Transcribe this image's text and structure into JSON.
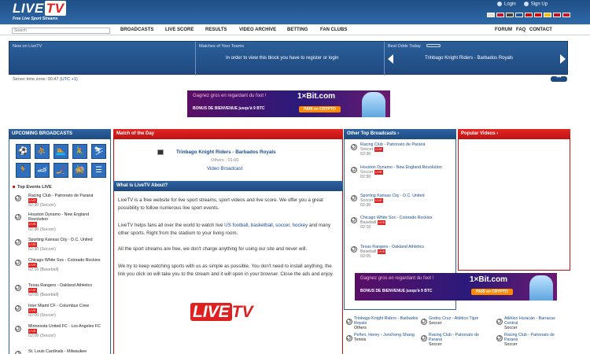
{
  "header": {
    "logo_live": "LIVE",
    "logo_tv": "TV",
    "tagline": "Free Live Sport Streams",
    "login": "Login",
    "signup": "Sign Up",
    "flags": [
      "#e0e0e0",
      "#c8102e",
      "#444",
      "#1e50a0",
      "#cc0000",
      "#d00",
      "#f1bf00",
      "#c60b1e",
      "#ce1126"
    ]
  },
  "nav": {
    "search_placeholder": "Search",
    "items": [
      "BROADCASTS",
      "LIVE SCORE",
      "RESULTS",
      "VIDEO ARCHIVE",
      "BETTING",
      "FAN CLUBS"
    ],
    "right": [
      "FORUM",
      "FAQ",
      "CONTACT"
    ]
  },
  "strip": {
    "new_label": "New on LiveTV",
    "matches_label": "Matches of Your Teams",
    "matches_msg": "In order to view this block you have to register or login",
    "odds_label": "Best Odds Today",
    "odds_match": "Trinbago Knight Riders - Barbados Royals",
    "server_time_label": "Server time zone: 00:47",
    "server_time_zone": "(UTC +1)",
    "dots": "•••"
  },
  "ad": {
    "line1": "Gagnez gros en regardant du foot !",
    "line2": "BONUS DE BIENVENUE jusqu'à 9 BTC",
    "brand": "1×Bit.com",
    "button": "PARI en CRYPTO"
  },
  "left": {
    "title": "UPCOMING BROADCASTS",
    "icons": [
      "⚽",
      "⛹",
      "🏊",
      "🚴",
      "⛷",
      "🏃",
      "🏎",
      "🏒",
      "🚵",
      "☰"
    ],
    "top_events": "Top Events LIVE",
    "events": [
      {
        "name": "Racing Club - Patronato de Paraná",
        "time": "02:30 (Soccer)"
      },
      {
        "name": "Houston Dynamo - New England Revolution",
        "time": "02:30 (Soccer)"
      },
      {
        "name": "Sporting Kansas City - D.C. United",
        "time": "02:30 (Soccer)"
      },
      {
        "name": "Chicago White Sox - Colorado Rockies",
        "time": "02:10 (Baseball)"
      },
      {
        "name": "Texas Rangers - Oakland Athletics",
        "time": "02:05 (Baseball)"
      },
      {
        "name": "Inter Miami CF - Columbus Crew",
        "time": "02:00 (Soccer)"
      },
      {
        "name": "Minnesota United FC - Los Angeles FC",
        "time": "02:00 (Soccer)"
      },
      {
        "name": "St. Louis Cardinals - Milwaukee",
        "time": ""
      }
    ]
  },
  "center": {
    "title": "Match of the Day",
    "match": "Trinbago Knight Riders - Barbados Royals",
    "meta": "Others , 01:00",
    "video": "Video Broadcast",
    "about_title": "What is LiveTV About?",
    "p1": "LiveTV is a free website for live sport streams, sport videos and live score. We offer you a great possibility to follow numerous live sport events.",
    "p2_a": "LiveTV helps fans all over the world to watch live ",
    "p2_links": [
      "US football",
      "basketball",
      "soccer",
      "hockey"
    ],
    "p2_b": " and many other sports. Right from the stadium to your living room.",
    "p3": "All the sport streams are free, we don't charge anything for using our site and never will.",
    "p4": "We try to keep watching sports with us as simple as possible. You don't need to install anything, the link you click on will take you to the stream and it will open in your browser. Close the ads and enjoy."
  },
  "other": {
    "title": "Other Top Broadcasts",
    "items": [
      {
        "name": "Racing Club - Patronato de Paraná",
        "sport": "Soccer",
        "time": "02:30"
      },
      {
        "name": "Houston Dynamo - New England Revolution",
        "sport": "Soccer",
        "time": "02:30"
      },
      {
        "name": "Sporting Kansas City - D.C. United",
        "sport": "Soccer",
        "time": "02:30"
      },
      {
        "name": "Chicago White Sox - Colorado Rockies",
        "sport": "Baseball",
        "time": "02:10"
      },
      {
        "name": "Texas Rangers - Oakland Athletics",
        "sport": "Baseball",
        "time": "02:05"
      }
    ],
    "live": "LIVE"
  },
  "popular": {
    "title": "Popular Videos"
  },
  "bottom": [
    {
      "name": "Trinbago Knight Riders - Barbados Royals",
      "sport": "Others"
    },
    {
      "name": "Godoy Cruz - Atlético Tigre",
      "sport": "Soccer"
    },
    {
      "name": "Atlético Huracán - Barracas Central",
      "sport": "Soccer"
    },
    {
      "name": "Peñen, Henry - Juncheng Shang",
      "sport": "Tennis"
    },
    {
      "name": "Racing Club - Patronato de Paraná",
      "sport": "Soccer"
    },
    {
      "name": "Racing Club - Patronato de Paraná",
      "sport": "Soccer"
    }
  ]
}
